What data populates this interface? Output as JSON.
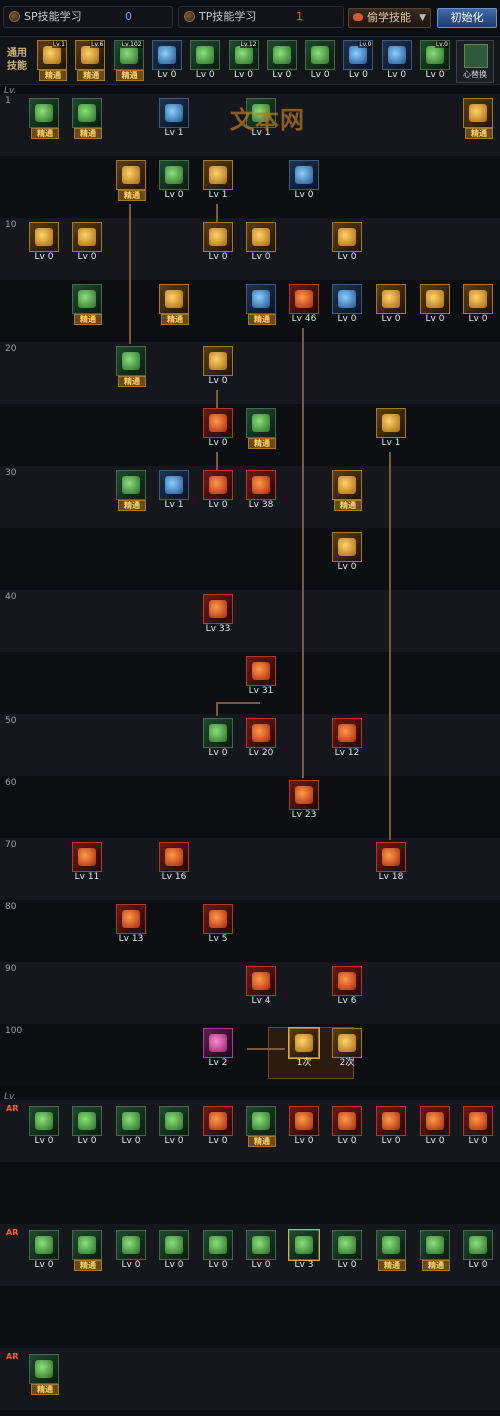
{
  "tabs": {
    "sp_label": "SP技能学习",
    "sp_points": "0",
    "tp_label": "TP技能学习",
    "tp_points": "1",
    "steal_label": "偷学技能",
    "reset_label": "初始化"
  },
  "common": {
    "label": "通用技能",
    "swap_label": "心替换",
    "skills": [
      {
        "label": "精通",
        "lvbadge": "Lv.1",
        "tone": "gold"
      },
      {
        "label": "精通",
        "lvbadge": "Lv.6",
        "tone": "gold"
      },
      {
        "label": "精通",
        "lvbadge": "Lv.102",
        "tone": "green"
      },
      {
        "label": "Lv 0",
        "lvbadge": "",
        "tone": "blue"
      },
      {
        "label": "Lv 0",
        "lvbadge": "",
        "tone": "green"
      },
      {
        "label": "Lv 0",
        "lvbadge": "Lv.12",
        "tone": "green"
      },
      {
        "label": "Lv 0",
        "lvbadge": "",
        "tone": "green"
      },
      {
        "label": "Lv 0",
        "lvbadge": "",
        "tone": "green"
      },
      {
        "label": "Lv 0",
        "lvbadge": "Lv.0",
        "tone": "blue"
      },
      {
        "label": "Lv 0",
        "lvbadge": "",
        "tone": "blue"
      },
      {
        "label": "Lv 0",
        "lvbadge": "Lv.0",
        "tone": "green"
      }
    ]
  },
  "tree": {
    "lv_header": "Lv.",
    "watermark": "文本网",
    "level_labels": [
      {
        "text": "1",
        "row": 0
      },
      {
        "text": "10",
        "row": 2
      },
      {
        "text": "20",
        "row": 4
      },
      {
        "text": "30",
        "row": 6
      },
      {
        "text": "40",
        "row": 8
      },
      {
        "text": "50",
        "row": 10
      },
      {
        "text": "60",
        "row": 11
      },
      {
        "text": "70",
        "row": 12
      },
      {
        "text": "80",
        "row": 13
      },
      {
        "text": "90",
        "row": 14
      },
      {
        "text": "100",
        "row": 15
      }
    ],
    "skills": [
      {
        "col": 0,
        "row": 0,
        "label": "精通",
        "tone": "green"
      },
      {
        "col": 1,
        "row": 0,
        "label": "精通",
        "tone": "green"
      },
      {
        "col": 3,
        "row": 0,
        "label": "Lv 1",
        "tone": "blue"
      },
      {
        "col": 5,
        "row": 0,
        "label": "Lv 1",
        "tone": "green"
      },
      {
        "col": 10,
        "row": 0,
        "label": "精通",
        "tone": "gold"
      },
      {
        "col": 2,
        "row": 1,
        "label": "精通",
        "tone": "gold"
      },
      {
        "col": 3,
        "row": 1,
        "label": "Lv 0",
        "tone": "green"
      },
      {
        "col": 4,
        "row": 1,
        "label": "Lv 1",
        "tone": "gold"
      },
      {
        "col": 6,
        "row": 1,
        "label": "Lv 0",
        "tone": "blue"
      },
      {
        "col": 0,
        "row": 2,
        "label": "Lv 0",
        "tone": "gold"
      },
      {
        "col": 1,
        "row": 2,
        "label": "Lv 0",
        "tone": "gold"
      },
      {
        "col": 4,
        "row": 2,
        "label": "Lv 0",
        "tone": "gold"
      },
      {
        "col": 5,
        "row": 2,
        "label": "Lv 0",
        "tone": "gold"
      },
      {
        "col": 7,
        "row": 2,
        "label": "Lv 0",
        "tone": "gold"
      },
      {
        "col": 1,
        "row": 3,
        "label": "精通",
        "tone": "green"
      },
      {
        "col": 3,
        "row": 3,
        "label": "精通",
        "tone": "gold"
      },
      {
        "col": 5,
        "row": 3,
        "label": "精通",
        "tone": "blue"
      },
      {
        "col": 6,
        "row": 3,
        "label": "Lv 46",
        "tone": "red"
      },
      {
        "col": 7,
        "row": 3,
        "label": "Lv 0",
        "tone": "blue"
      },
      {
        "col": 8,
        "row": 3,
        "label": "Lv 0",
        "tone": "gold"
      },
      {
        "col": 9,
        "row": 3,
        "label": "Lv 0",
        "tone": "gold"
      },
      {
        "col": 10,
        "row": 3,
        "label": "Lv 0",
        "tone": "gold"
      },
      {
        "col": 2,
        "row": 4,
        "label": "精通",
        "tone": "green"
      },
      {
        "col": 4,
        "row": 4,
        "label": "Lv 0",
        "tone": "gold"
      },
      {
        "col": 4,
        "row": 5,
        "label": "Lv 0",
        "tone": "red"
      },
      {
        "col": 5,
        "row": 5,
        "label": "精通",
        "tone": "green"
      },
      {
        "col": 8,
        "row": 5,
        "label": "Lv 1",
        "tone": "gold"
      },
      {
        "col": 2,
        "row": 6,
        "label": "精通",
        "tone": "green"
      },
      {
        "col": 3,
        "row": 6,
        "label": "Lv 1",
        "tone": "blue"
      },
      {
        "col": 4,
        "row": 6,
        "label": "Lv 0",
        "tone": "red"
      },
      {
        "col": 5,
        "row": 6,
        "label": "Lv 38",
        "tone": "red"
      },
      {
        "col": 7,
        "row": 6,
        "label": "精通",
        "tone": "gold"
      },
      {
        "col": 7,
        "row": 7,
        "label": "Lv 0",
        "tone": "gold"
      },
      {
        "col": 4,
        "row": 8,
        "label": "Lv 33",
        "tone": "red"
      },
      {
        "col": 5,
        "row": 9,
        "label": "Lv 31",
        "tone": "red"
      },
      {
        "col": 4,
        "row": 10,
        "label": "Lv 0",
        "tone": "green"
      },
      {
        "col": 5,
        "row": 10,
        "label": "Lv 20",
        "tone": "red"
      },
      {
        "col": 7,
        "row": 10,
        "label": "Lv 12",
        "tone": "red"
      },
      {
        "col": 6,
        "row": 11,
        "label": "Lv 23",
        "tone": "red"
      },
      {
        "col": 1,
        "row": 12,
        "label": "Lv 11",
        "tone": "red"
      },
      {
        "col": 3,
        "row": 12,
        "label": "Lv 16",
        "tone": "red"
      },
      {
        "col": 8,
        "row": 12,
        "label": "Lv 18",
        "tone": "red"
      },
      {
        "col": 2,
        "row": 13,
        "label": "Lv 13",
        "tone": "red"
      },
      {
        "col": 4,
        "row": 13,
        "label": "Lv 5",
        "tone": "red"
      },
      {
        "col": 5,
        "row": 14,
        "label": "Lv 4",
        "tone": "red"
      },
      {
        "col": 7,
        "row": 14,
        "label": "Lv 6",
        "tone": "red"
      },
      {
        "col": 4,
        "row": 15,
        "label": "Lv 2",
        "tone": "purple"
      },
      {
        "col": 6,
        "row": 15,
        "label": "1次",
        "tone": "gold",
        "sel": true
      },
      {
        "col": 7,
        "row": 15,
        "label": "2次",
        "tone": "gold"
      }
    ]
  },
  "tp": {
    "lv_header": "Lv.",
    "row_mark": "AR",
    "rows": [
      {
        "row": 0,
        "skills": [
          {
            "label": "Lv 0",
            "tone": "green"
          },
          {
            "label": "Lv 0",
            "tone": "green"
          },
          {
            "label": "Lv 0",
            "tone": "green"
          },
          {
            "label": "Lv 0",
            "tone": "green"
          },
          {
            "label": "Lv 0",
            "tone": "red"
          },
          {
            "label": "精通",
            "tone": "green"
          },
          {
            "label": "Lv 0",
            "tone": "red"
          },
          {
            "label": "Lv 0",
            "tone": "red"
          },
          {
            "label": "Lv 0",
            "tone": "red"
          },
          {
            "label": "Lv 0",
            "tone": "red"
          },
          {
            "label": "Lv 0",
            "tone": "red"
          }
        ]
      },
      {
        "row": 2,
        "skills": [
          {
            "label": "Lv 0",
            "tone": "green"
          },
          {
            "label": "精通",
            "tone": "green"
          },
          {
            "label": "Lv 0",
            "tone": "green"
          },
          {
            "label": "Lv 0",
            "tone": "green"
          },
          {
            "label": "Lv 0",
            "tone": "green"
          },
          {
            "label": "Lv 0",
            "tone": "green"
          },
          {
            "label": "Lv 3",
            "tone": "green",
            "sel": true
          },
          {
            "label": "Lv 0",
            "tone": "green"
          },
          {
            "label": "精通",
            "tone": "green"
          },
          {
            "label": "精通",
            "tone": "green"
          },
          {
            "label": "Lv 0",
            "tone": "green"
          }
        ]
      },
      {
        "row": 4,
        "skills": [
          {
            "label": "精通",
            "tone": "green"
          }
        ]
      }
    ]
  }
}
